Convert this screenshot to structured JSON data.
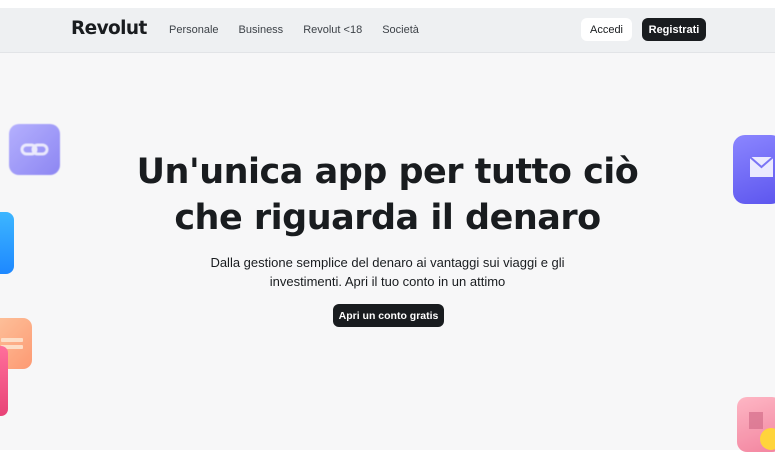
{
  "header": {
    "logo": "Revolut",
    "nav": [
      "Personale",
      "Business",
      "Revolut <18",
      "Società"
    ],
    "login_label": "Accedi",
    "signup_label": "Registrati"
  },
  "hero": {
    "title_line1": "Un'unica app per tutto ciò",
    "title_line2": "che riguarda il denaro",
    "subtitle_line1": "Dalla gestione semplice del denaro ai vantaggi sui viaggi e gli",
    "subtitle_line2": "investimenti. Apri il tuo conto in un attimo",
    "cta_label": "Apri un conto gratis"
  },
  "colors": {
    "primary_button": "#191c1f",
    "header_bg": "#eef0f2",
    "page_bg": "#f7f7f8"
  },
  "icons": [
    "link-icon",
    "envelope-icon",
    "cash-icon",
    "gift-icon"
  ]
}
